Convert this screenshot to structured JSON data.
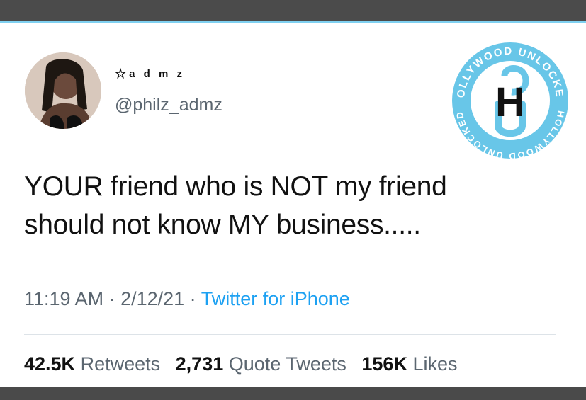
{
  "tweet": {
    "display_name": "a d m z",
    "handle": "@philz_admz",
    "text_line1": "YOUR friend who is NOT my friend",
    "text_line2": "should not know MY business.....",
    "time": "11:19 AM",
    "date": "2/12/21",
    "source": "Twitter for iPhone",
    "separator": " · "
  },
  "stats": {
    "retweets_count": "42.5K",
    "retweets_label": "Retweets",
    "quote_count": "2,731",
    "quote_label": "Quote Tweets",
    "likes_count": "156K",
    "likes_label": "Likes"
  },
  "watermark": {
    "top_text": "HOLLYWOOD UNLOCKED",
    "bottom_text": "HOLLYWOOD UNLOCKED",
    "monogram": "H"
  },
  "colors": {
    "card_border": "#7fd0f0",
    "link": "#1da1f2",
    "logo_blue": "#68c6e8"
  }
}
